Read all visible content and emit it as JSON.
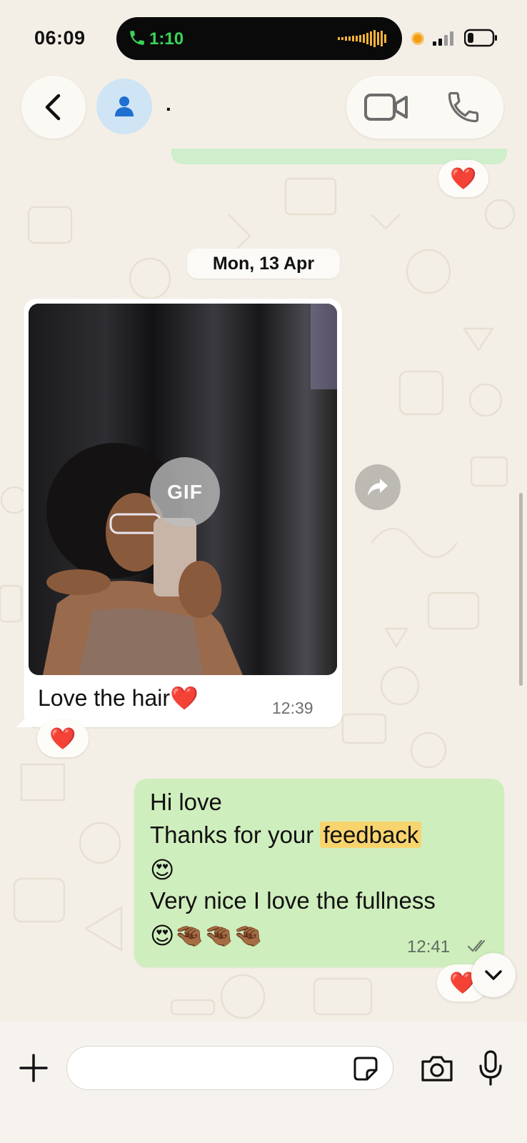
{
  "status_bar": {
    "time": "06:09",
    "call_duration": "1:10",
    "call_color": "#3ad25a",
    "recording_dot_color": "#f39c12"
  },
  "header": {
    "back_icon": "chevron-left-icon",
    "avatar_icon": "person-icon",
    "contact_name": ".",
    "video_icon": "video-camera-icon",
    "phone_icon": "phone-icon"
  },
  "chat": {
    "date_separator": "Mon, 13 Apr",
    "incoming": {
      "media_badge": "GIF",
      "caption": "Love the hair❤️",
      "time": "12:39",
      "reaction": "❤️"
    },
    "outgoing": {
      "lines": [
        "Hi love",
        "Thanks for your",
        "feedback",
        "😍",
        "Very nice I love the fullness",
        "😍🤏🏾🤏🏾🤏🏾"
      ],
      "time": "12:41",
      "status": "read",
      "reaction": "❤️",
      "highlight_color": "#f8d46e",
      "bubble_color": "#cfeebd"
    },
    "top_reaction": "❤️"
  },
  "composer": {
    "placeholder": "",
    "value": "",
    "icons": [
      "plus-icon",
      "sticker-icon",
      "camera-icon",
      "microphone-icon"
    ]
  },
  "colors": {
    "background": "#f4efe6",
    "accent_green": "#3ad25a"
  }
}
